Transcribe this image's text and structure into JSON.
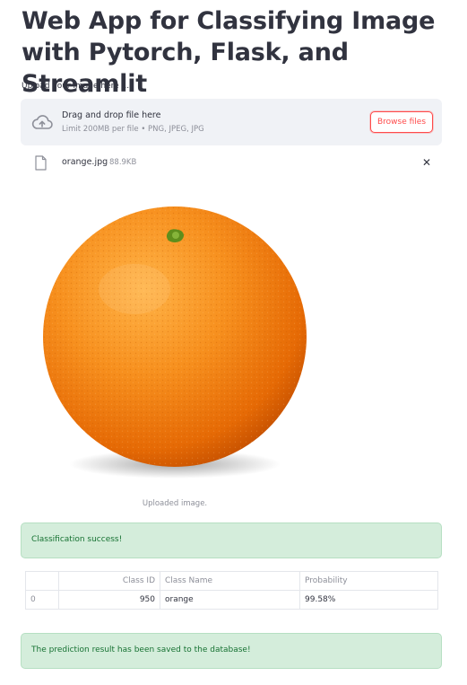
{
  "page": {
    "title": "Web App for Classifying Image with Pytorch, Flask, and Streamlit"
  },
  "uploader": {
    "label": "Upload your image here ...",
    "drop_title": "Drag and drop file here",
    "limit_text": "Limit 200MB per file • PNG, JPEG, JPG",
    "browse_label": "Browse files",
    "cloud_icon": "cloud-upload-icon",
    "accent_color": "#ff4b4b"
  },
  "file": {
    "name": "orange.jpg",
    "size": "88.9KB",
    "file_icon": "file-icon",
    "close_glyph": "✕"
  },
  "image": {
    "caption": "Uploaded image."
  },
  "alerts": {
    "classification": "Classification success!",
    "saved": "The prediction result has been saved to the database!",
    "success_color": "#d4eddb"
  },
  "table": {
    "headers": [
      "",
      "Class ID",
      "Class Name",
      "Probability"
    ],
    "rows": [
      {
        "index": "0",
        "class_id": "950",
        "class_name": "orange",
        "probability": "99.58%"
      }
    ]
  }
}
